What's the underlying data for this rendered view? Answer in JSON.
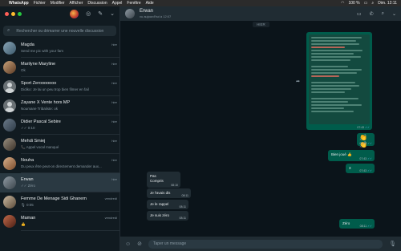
{
  "menubar": {
    "app_name": "WhatsApp",
    "items": [
      "Fichier",
      "Modifier",
      "Afficher",
      "Discussion",
      "Appel",
      "Fenêtre",
      "Aide"
    ],
    "battery": "100 %",
    "clock": "Dim. 12:11"
  },
  "sidebar": {
    "search_placeholder": "Rechercher ou démarrer une nouvelle discussion",
    "chats": [
      {
        "name": "Magda",
        "preview": "Send me pic with your fam",
        "time": "hier"
      },
      {
        "name": "Marilyne Maryline",
        "preview": "Ok",
        "time": "hier"
      },
      {
        "name": "Sport Zerooooooo",
        "preview": "Didiko: Je lai un peu trop bien filmer en fail",
        "time": "hier"
      },
      {
        "name": "Zayane X Vente hors MP",
        "preview": "Noumane Tribaliste: ok",
        "time": "hier"
      },
      {
        "name": "Didier Pascal Sebire",
        "preview": "✓✓ 0:10",
        "time": "hier"
      },
      {
        "name": "Mehdi Smiej",
        "preview": "📞 Appel vocal manqué",
        "time": "hier"
      },
      {
        "name": "Nouha",
        "preview": "Du peux être peut-on directement demander aux...",
        "time": "hier"
      },
      {
        "name": "Erwan",
        "preview": "✓✓ Zéro",
        "time": "hier"
      },
      {
        "name": "Femme De Menage Sidi Ghanem",
        "preview": "🎙 0:05",
        "time": "vendredi"
      },
      {
        "name": "Maman",
        "preview": "👍",
        "time": "vendredi"
      }
    ]
  },
  "chat": {
    "name": "Erwan",
    "status": "vu aujourd'hui à 12:07",
    "day_label": "HIER",
    "long_message_time": "07:43",
    "messages": [
      {
        "text": "👏👏",
        "time": "07:43",
        "dir": "out"
      },
      {
        "text": "Bien joué 👍",
        "time": "07:43",
        "dir": "out"
      },
      {
        "text": "3",
        "time": "07:43",
        "dir": "out"
      },
      {
        "text": "Pas Compris",
        "time": "08:10",
        "dir": "in"
      },
      {
        "text": "Je l'avais dis",
        "time": "08:11",
        "dir": "in"
      },
      {
        "text": "Je le rappel",
        "time": "08:11",
        "dir": "in"
      },
      {
        "text": "Je suis zéro",
        "time": "08:11",
        "dir": "in"
      },
      {
        "text": "Zéro",
        "time": "08:11",
        "dir": "out"
      }
    ],
    "composer_placeholder": "Taper un message"
  }
}
